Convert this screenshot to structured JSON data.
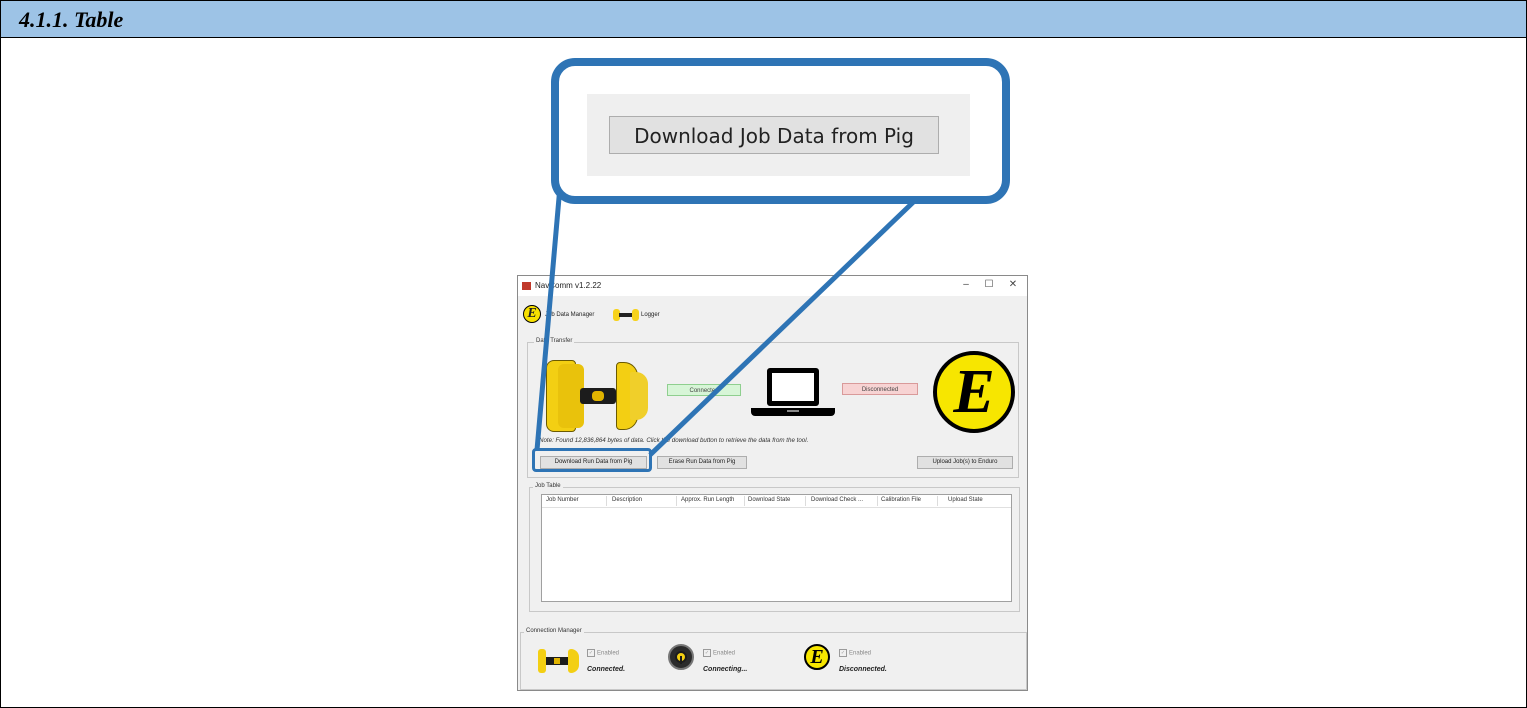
{
  "section": {
    "title": "4.1.1. Table"
  },
  "callout": {
    "button_label": "Download Job Data from Pig"
  },
  "window": {
    "title": "NavComm v1.2.22",
    "controls": {
      "minimize": "–",
      "maximize": "☐",
      "close": "✕"
    },
    "tabs": [
      {
        "label": "Job Data Manager"
      },
      {
        "label": "Logger"
      }
    ],
    "data_transfer": {
      "label": "Data Transfer",
      "status_left": "Connected",
      "status_right": "Disconnected",
      "note": "Note:  Found 12,836,864 bytes of data. Click the download button to retrieve the data from the tool.",
      "download_button": "Download Run Data from Pig",
      "erase_button": "Erase Run Data from Pig",
      "upload_button": "Upload Job(s) to Enduro",
      "logo_letter": "E"
    },
    "job_table": {
      "label": "Job Table",
      "columns": [
        "Job Number",
        "Description",
        "Approx. Run Length",
        "Download State",
        "Download Check ...",
        "Calibration File",
        "Upload State"
      ]
    },
    "connection_manager": {
      "label": "Connection Manager",
      "items": [
        {
          "checkbox": "Enabled",
          "status": "Connected."
        },
        {
          "checkbox": "Enabled",
          "status": "Connecting..."
        },
        {
          "checkbox": "Enabled",
          "status": "Disconnected."
        }
      ]
    }
  },
  "colors": {
    "header_band": "#9dc3e6",
    "callout_border": "#2e74b5",
    "connected_fill": "#d7f5d7",
    "disconnected_fill": "#f7d3d3",
    "brand_yellow": "#f7e600"
  }
}
